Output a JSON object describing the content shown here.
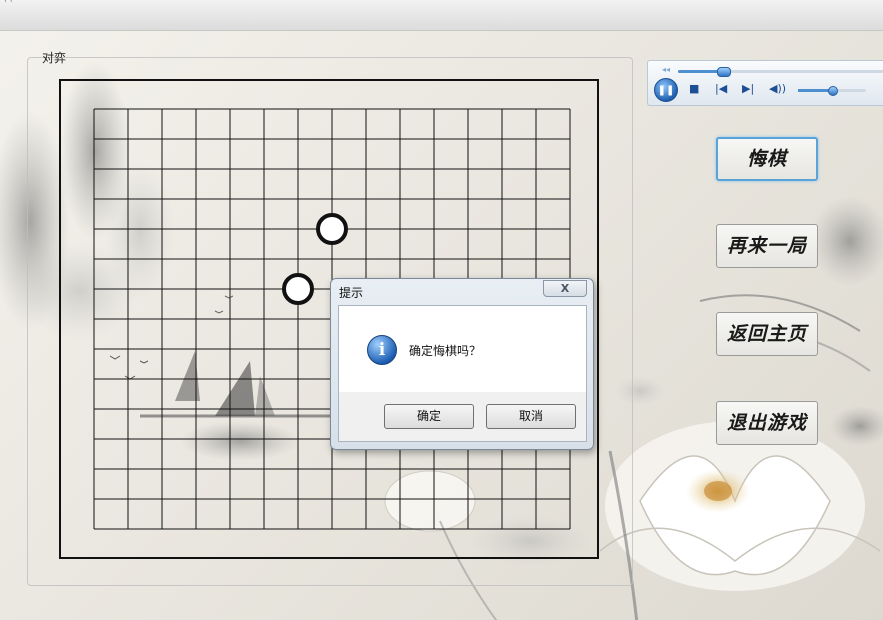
{
  "window": {
    "title_fragment": "· ·"
  },
  "group": {
    "title": "对弈"
  },
  "board": {
    "columns": 14,
    "rows": 14,
    "stones": [
      {
        "color": "white",
        "col": 7,
        "row": 4
      },
      {
        "color": "white",
        "col": 6,
        "row": 6
      }
    ]
  },
  "player": {
    "seek_progress": 0.12,
    "volume": 0.5,
    "play_icon": "pause-icon",
    "stop_icon": "stop-icon",
    "prev_icon": "previous-icon",
    "next_icon": "next-icon",
    "volume_icon": "speaker-icon"
  },
  "buttons": {
    "undo": "悔棋",
    "restart": "再来一局",
    "home": "返回主页",
    "exit": "退出游戏"
  },
  "dialog": {
    "title": "提示",
    "close": "X",
    "message": "确定悔棋吗？",
    "ok": "确定",
    "cancel": "取消",
    "icon": "info-icon"
  },
  "colors": {
    "focus_accent": "#5aa3d8",
    "media_blue": "#1f5fae"
  }
}
